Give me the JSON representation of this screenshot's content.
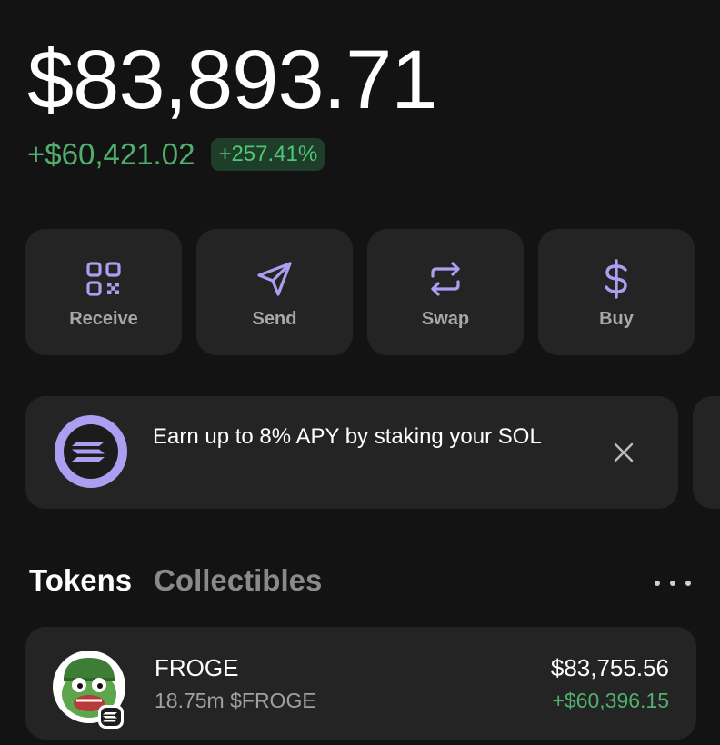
{
  "balance": {
    "total": "$83,893.71",
    "change_amount": "+$60,421.02",
    "change_percent": "+257.41%"
  },
  "actions": [
    {
      "label": "Receive",
      "icon": "qr-code-icon"
    },
    {
      "label": "Send",
      "icon": "send-arrow-icon"
    },
    {
      "label": "Swap",
      "icon": "swap-arrows-icon"
    },
    {
      "label": "Buy",
      "icon": "dollar-icon"
    }
  ],
  "banner": {
    "text": "Earn up to 8% APY by staking your SOL",
    "icon": "solana-logo-icon",
    "close_icon": "close-icon"
  },
  "tabs": {
    "active": "Tokens",
    "inactive": "Collectibles",
    "more_icon": "more-horizontal-icon"
  },
  "tokens": [
    {
      "name": "FROGE",
      "amount": "18.75m $FROGE",
      "value": "$83,755.56",
      "change": "+$60,396.15"
    }
  ],
  "colors": {
    "background": "#131313",
    "card": "#242424",
    "accent": "#ab9ff2",
    "positive": "#4fb06e"
  }
}
